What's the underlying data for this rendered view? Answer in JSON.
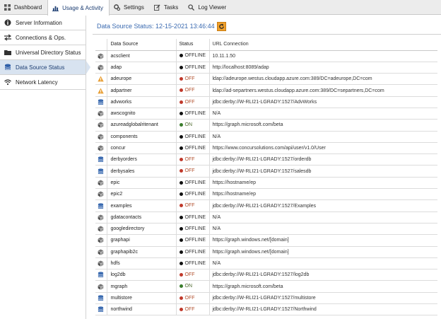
{
  "nav": {
    "tabs": [
      {
        "label": "Dashboard",
        "icon": "dashboard-icon"
      },
      {
        "label": "Usage & Activity",
        "icon": "bar-chart-icon",
        "active": true
      },
      {
        "label": "Settings",
        "icon": "gears-icon"
      },
      {
        "label": "Tasks",
        "icon": "edit-icon"
      },
      {
        "label": "Log Viewer",
        "icon": "search-icon"
      }
    ]
  },
  "sidebar": {
    "items": [
      {
        "label": "Server Information",
        "icon": "info-icon"
      },
      {
        "label": "Connections & Ops.",
        "icon": "exchange-icon"
      },
      {
        "label": "Universal Directory Status",
        "icon": "folder-icon"
      },
      {
        "label": "Data Source Status",
        "icon": "database-icon",
        "active": true
      },
      {
        "label": "Network Latency",
        "icon": "wifi-icon"
      }
    ]
  },
  "main": {
    "title": "Data Source Status: 12-15-2021 13:46:44",
    "refresh_icon": "refresh-icon",
    "columns": [
      "Data Source",
      "Status",
      "URL Connection"
    ],
    "rows": [
      {
        "icon": "cube",
        "name": "acsclient",
        "status": "OFFLINE",
        "url": "10.11.1.50"
      },
      {
        "icon": "cube",
        "name": "adap",
        "status": "OFFLINE",
        "url": "http://localhost:8089/adap"
      },
      {
        "icon": "warning",
        "name": "adeurope",
        "status": "OFF",
        "url": "ldap://adeurope.westus.cloudapp.azure.com:389/DC=adeurope,DC=com"
      },
      {
        "icon": "warning",
        "name": "adpartner",
        "status": "OFF",
        "url": "ldap://ad-separtners.westus.cloudapp.azure.com:389/DC=separtners,DC=com"
      },
      {
        "icon": "database",
        "name": "advworks",
        "status": "OFF",
        "url": "jdbc:derby://W-RLI21-LGRADY:1527/AdvWorks"
      },
      {
        "icon": "cube",
        "name": "awscognito",
        "status": "OFFLINE",
        "url": "N/A"
      },
      {
        "icon": "cube",
        "name": "azureadglobalritenant",
        "status": "ON",
        "url": "https://graph.microsoft.com/beta"
      },
      {
        "icon": "cube",
        "name": "components",
        "status": "OFFLINE",
        "url": "N/A"
      },
      {
        "icon": "cube",
        "name": "concur",
        "status": "OFFLINE",
        "url": "https://www.concursolutions.com/api/user/v1.0/User"
      },
      {
        "icon": "database",
        "name": "derbyorders",
        "status": "OFF",
        "url": "jdbc:derby://W-RLI21-LGRADY:1527/orderdb"
      },
      {
        "icon": "database",
        "name": "derbysales",
        "status": "OFF",
        "url": "jdbc:derby://W-RLI21-LGRADY:1527/salesdb"
      },
      {
        "icon": "cube",
        "name": "epic",
        "status": "OFFLINE",
        "url": "https://hostname/ep"
      },
      {
        "icon": "cube",
        "name": "epic2",
        "status": "OFFLINE",
        "url": "https://hostname/ep"
      },
      {
        "icon": "database",
        "name": "examples",
        "status": "OFF",
        "url": "jdbc:derby://W-RLI21-LGRADY:1527/Examples"
      },
      {
        "icon": "cube",
        "name": "gdatacontacts",
        "status": "OFFLINE",
        "url": "N/A"
      },
      {
        "icon": "cube",
        "name": "googledirectory",
        "status": "OFFLINE",
        "url": "N/A"
      },
      {
        "icon": "cube",
        "name": "graphapi",
        "status": "OFFLINE",
        "url": "https://graph.windows.net/[domain]"
      },
      {
        "icon": "cube",
        "name": "graphapib2c",
        "status": "OFFLINE",
        "url": "https://graph.windows.net/[domain]"
      },
      {
        "icon": "cube",
        "name": "hdfs",
        "status": "OFFLINE",
        "url": "N/A"
      },
      {
        "icon": "database",
        "name": "log2db",
        "status": "OFF",
        "url": "jdbc:derby://W-RLI21-LGRADY:1527/log2db"
      },
      {
        "icon": "cube",
        "name": "mgraph",
        "status": "ON",
        "url": "https://graph.microsoft.com/beta"
      },
      {
        "icon": "database",
        "name": "multistore",
        "status": "OFF",
        "url": "jdbc:derby://W-RLI21-LGRADY:1527/multistore"
      },
      {
        "icon": "database",
        "name": "northwind",
        "status": "OFF",
        "url": "jdbc:derby://W-RLI21-LGRADY:1527/Northwind"
      }
    ]
  },
  "colors": {
    "accent": "#3a6ab0",
    "active_bg": "#d8e3f0",
    "off": "#c0392b",
    "on": "#3a7d2c",
    "offline": "#111111",
    "refresh": "#f0a02c"
  }
}
